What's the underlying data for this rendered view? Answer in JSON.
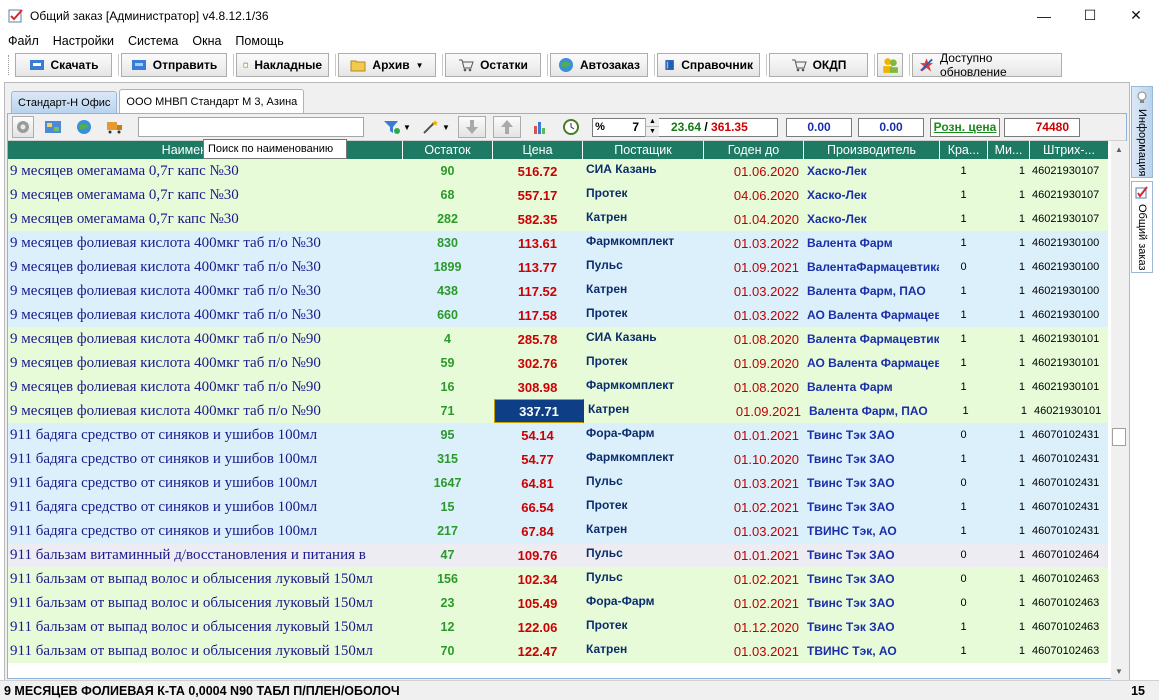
{
  "window": {
    "title": "Общий заказ [Администратор] v4.8.12.1/36",
    "minimize": "—",
    "maximize": "☐",
    "close": "✕"
  },
  "menu": [
    "Файл",
    "Настройки",
    "Система",
    "Окна",
    "Помощь"
  ],
  "toolbar": {
    "download": "Скачать",
    "send": "Отправить",
    "invoices": "Накладные",
    "archive": "Архив",
    "stock": "Остатки",
    "autoorder": "Автозаказ",
    "reference": "Справочник",
    "okdp": "ОКДП",
    "update": "Доступно обновление"
  },
  "tabs": [
    "Стандарт-Н Офис",
    "ООО МНВП Стандарт М 3, Азина"
  ],
  "toolbar2": {
    "search_value": "",
    "percent_sign": "%",
    "percent_value": "7",
    "sum_green": "23.64",
    "sum_sep": " / ",
    "sum_red": "361.35",
    "box1": "0.00",
    "box2": "0.00",
    "price_mode": "Розн. цена",
    "total": "74480"
  },
  "tooltip": "Поиск по наименованию",
  "columns": [
    "Наименование",
    "Остаток",
    "Цена",
    "Постащик",
    "Годен до",
    "Производитель",
    "Кра...",
    "Ми...",
    "Штрих-..."
  ],
  "rows": [
    {
      "name": "9 месяцев омегамама 0,7г капс  №30",
      "stock": "90",
      "price": "516.72",
      "supplier": "СИА Казань",
      "date": "01.06.2020",
      "maker": "Хаско-Лек",
      "kr": "1",
      "min": "1",
      "code": "46021930107",
      "bg": "green"
    },
    {
      "name": "9 месяцев омегамама 0,7г капс  №30",
      "stock": "68",
      "price": "557.17",
      "supplier": "Протек",
      "date": "04.06.2020",
      "maker": "Хаско-Лек",
      "kr": "1",
      "min": "1",
      "code": "46021930107",
      "bg": "green"
    },
    {
      "name": "9 месяцев омегамама 0,7г капс  №30",
      "stock": "282",
      "price": "582.35",
      "supplier": "Катрен",
      "date": "01.04.2020",
      "maker": "Хаско-Лек",
      "kr": "1",
      "min": "1",
      "code": "46021930107",
      "bg": "green"
    },
    {
      "name": "9 месяцев фолиевая кислота 400мкг таб п/о  №30",
      "stock": "830",
      "price": "113.61",
      "supplier": "Фармкомплект",
      "date": "01.03.2022",
      "maker": "Валента Фарм",
      "kr": "1",
      "min": "1",
      "code": "46021930100",
      "bg": "blue"
    },
    {
      "name": "9 месяцев фолиевая кислота 400мкг таб п/о  №30",
      "stock": "1899",
      "price": "113.77",
      "supplier": "Пульс",
      "date": "01.09.2021",
      "maker": "ВалентаФармацевтика",
      "kr": "0",
      "min": "1",
      "code": "46021930100",
      "bg": "blue"
    },
    {
      "name": "9 месяцев фолиевая кислота 400мкг таб п/о  №30",
      "stock": "438",
      "price": "117.52",
      "supplier": "Катрен",
      "date": "01.03.2022",
      "maker": "Валента Фарм, ПАО",
      "kr": "1",
      "min": "1",
      "code": "46021930100",
      "bg": "blue"
    },
    {
      "name": "9 месяцев фолиевая кислота 400мкг таб п/о  №30",
      "stock": "660",
      "price": "117.58",
      "supplier": "Протек",
      "date": "01.03.2022",
      "maker": "АО Валента Фармацевт",
      "kr": "1",
      "min": "1",
      "code": "46021930100",
      "bg": "blue"
    },
    {
      "name": "9 месяцев фолиевая кислота 400мкг таб п/о  №90",
      "stock": "4",
      "price": "285.78",
      "supplier": "СИА Казань",
      "date": "01.08.2020",
      "maker": "Валента Фармацевтика",
      "kr": "1",
      "min": "1",
      "code": "46021930101",
      "bg": "green"
    },
    {
      "name": "9 месяцев фолиевая кислота 400мкг таб п/о  №90",
      "stock": "59",
      "price": "302.76",
      "supplier": "Протек",
      "date": "01.09.2020",
      "maker": "АО Валента Фармацевт",
      "kr": "1",
      "min": "1",
      "code": "46021930101",
      "bg": "green"
    },
    {
      "name": "9 месяцев фолиевая кислота 400мкг таб п/о  №90",
      "stock": "16",
      "price": "308.98",
      "supplier": "Фармкомплект",
      "date": "01.08.2020",
      "maker": "Валента Фарм",
      "kr": "1",
      "min": "1",
      "code": "46021930101",
      "bg": "green"
    },
    {
      "name": "9 месяцев фолиевая кислота 400мкг таб п/о  №90",
      "stock": "71",
      "price": "337.71",
      "supplier": "Катрен",
      "date": "01.09.2021",
      "maker": "Валента Фарм, ПАО",
      "kr": "1",
      "min": "1",
      "code": "46021930101",
      "bg": "green",
      "selected": true
    },
    {
      "name": "911 бадяга средство от синяков и ушибов 100мл",
      "stock": "95",
      "price": "54.14",
      "supplier": "Фора-Фарм",
      "date": "01.01.2021",
      "maker": "Твинс Тэк ЗАО",
      "kr": "0",
      "min": "1",
      "code": "46070102431",
      "bg": "blue"
    },
    {
      "name": "911 бадяга средство от синяков и ушибов 100мл",
      "stock": "315",
      "price": "54.77",
      "supplier": "Фармкомплект",
      "date": "01.10.2020",
      "maker": "Твинс Тэк ЗАО",
      "kr": "1",
      "min": "1",
      "code": "46070102431",
      "bg": "blue"
    },
    {
      "name": "911 бадяга средство от синяков и ушибов 100мл",
      "stock": "1647",
      "price": "64.81",
      "supplier": "Пульс",
      "date": "01.03.2021",
      "maker": "Твинс Тэк ЗАО",
      "kr": "0",
      "min": "1",
      "code": "46070102431",
      "bg": "blue"
    },
    {
      "name": "911 бадяга средство от синяков и ушибов 100мл",
      "stock": "15",
      "price": "66.54",
      "supplier": "Протек",
      "date": "01.02.2021",
      "maker": "Твинс Тэк ЗАО",
      "kr": "1",
      "min": "1",
      "code": "46070102431",
      "bg": "blue"
    },
    {
      "name": "911 бадяга средство от синяков и ушибов 100мл",
      "stock": "217",
      "price": "67.84",
      "supplier": "Катрен",
      "date": "01.03.2021",
      "maker": "ТВИНС Тэк, АО",
      "kr": "1",
      "min": "1",
      "code": "46070102431",
      "bg": "blue"
    },
    {
      "name": "911 бальзам витаминный д/восстановления и питания в",
      "stock": "47",
      "price": "109.76",
      "supplier": "Пульс",
      "date": "01.01.2021",
      "maker": "Твинс Тэк ЗАО",
      "kr": "0",
      "min": "1",
      "code": "46070102464",
      "bg": "grey"
    },
    {
      "name": "911 бальзам от выпад волос и облысения луковый 150мл",
      "stock": "156",
      "price": "102.34",
      "supplier": "Пульс",
      "date": "01.02.2021",
      "maker": "Твинс Тэк ЗАО",
      "kr": "0",
      "min": "1",
      "code": "46070102463",
      "bg": "green"
    },
    {
      "name": "911 бальзам от выпад волос и облысения луковый 150мл",
      "stock": "23",
      "price": "105.49",
      "supplier": "Фора-Фарм",
      "date": "01.02.2021",
      "maker": "Твинс Тэк ЗАО",
      "kr": "0",
      "min": "1",
      "code": "46070102463",
      "bg": "green"
    },
    {
      "name": "911 бальзам от выпад волос и облысения луковый 150мл",
      "stock": "12",
      "price": "122.06",
      "supplier": "Протек",
      "date": "01.12.2020",
      "maker": "Твинс Тэк ЗАО",
      "kr": "1",
      "min": "1",
      "code": "46070102463",
      "bg": "green"
    },
    {
      "name": "911 бальзам от выпад волос и облысения луковый 150мл",
      "stock": "70",
      "price": "122.47",
      "supplier": "Катрен",
      "date": "01.03.2021",
      "maker": "ТВИНС Тэк, АО",
      "kr": "1",
      "min": "1",
      "code": "46070102463",
      "bg": "green"
    }
  ],
  "side_tabs": [
    "Информация",
    "Общий заказ"
  ],
  "status": {
    "text": "9 МЕСЯЦЕВ ФОЛИЕВАЯ К-ТА 0,0004 N90 ТАБЛ П/ПЛЕН/ОБОЛОЧ",
    "count": "15"
  },
  "colors": {
    "header_bg": "#1e7a63",
    "row_green": "#e7fbd9",
    "row_blue": "#dcf0fb",
    "selection": "#0e3f86"
  }
}
